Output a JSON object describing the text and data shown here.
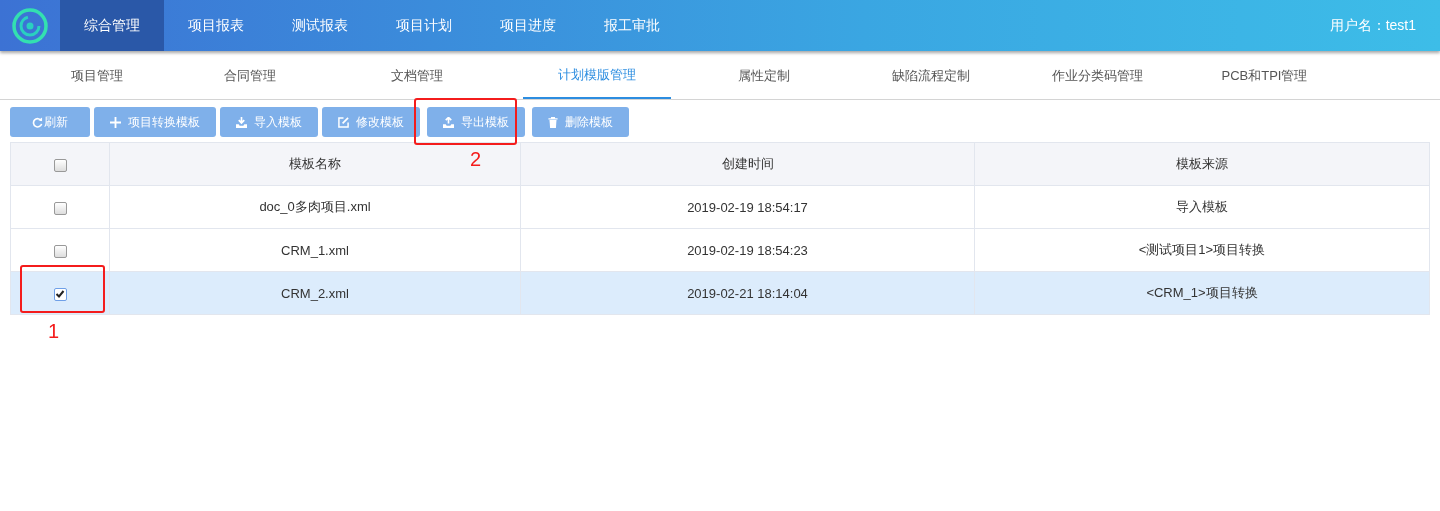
{
  "nav": {
    "items": [
      {
        "label": "综合管理",
        "selected": true
      },
      {
        "label": "项目报表",
        "selected": false
      },
      {
        "label": "测试报表",
        "selected": false
      },
      {
        "label": "项目计划",
        "selected": false
      },
      {
        "label": "项目进度",
        "selected": false
      },
      {
        "label": "报工审批",
        "selected": false
      }
    ],
    "user": "用户名：test1"
  },
  "subnav": [
    {
      "label": "项目管理",
      "selected": false
    },
    {
      "label": "合同管理",
      "selected": false
    },
    {
      "label": "文档管理",
      "selected": false
    },
    {
      "label": "计划模版管理",
      "selected": true
    },
    {
      "label": "属性定制",
      "selected": false
    },
    {
      "label": "缺陷流程定制",
      "selected": false
    },
    {
      "label": "作业分类码管理",
      "selected": false
    },
    {
      "label": "PCB和TPI管理",
      "selected": false
    }
  ],
  "toolbar": [
    {
      "kind": "refresh",
      "label": "刷新"
    },
    {
      "kind": "add",
      "label": "项目转换模板"
    },
    {
      "kind": "import",
      "label": "导入模板"
    },
    {
      "kind": "edit",
      "label": "修改模板"
    },
    {
      "kind": "export",
      "label": "导出模板"
    },
    {
      "kind": "delete",
      "label": "删除模板"
    }
  ],
  "table": {
    "header_checked": false,
    "columns": [
      "模板名称",
      "创建时间",
      "模板来源"
    ],
    "rows": [
      {
        "checked": false,
        "cells": [
          "doc_0多肉项目.xml",
          "2019-02-19 18:54:17",
          "导入模板"
        ]
      },
      {
        "checked": false,
        "cells": [
          "CRM_1.xml",
          "2019-02-19 18:54:23",
          "<测试项目1>项目转换"
        ]
      },
      {
        "checked": true,
        "cells": [
          "CRM_2.xml",
          "2019-02-21 18:14:04",
          "<CRM_1>项目转换"
        ]
      }
    ]
  },
  "annotations": [
    "1",
    "2"
  ]
}
